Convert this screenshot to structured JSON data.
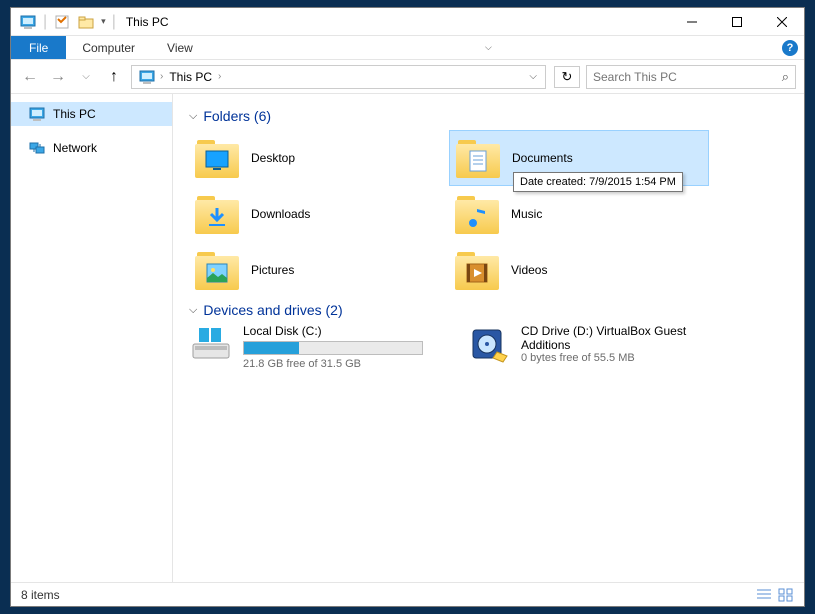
{
  "window": {
    "title": "This PC"
  },
  "menubar": {
    "file": "File",
    "computer": "Computer",
    "view": "View"
  },
  "breadcrumb": {
    "current": "This PC"
  },
  "search": {
    "placeholder": "Search This PC"
  },
  "sidebar": {
    "items": [
      {
        "label": "This PC",
        "selected": true
      },
      {
        "label": "Network",
        "selected": false
      }
    ]
  },
  "sections": {
    "folders": {
      "title": "Folders",
      "count": "(6)",
      "items": [
        {
          "label": "Desktop"
        },
        {
          "label": "Documents",
          "selected": true
        },
        {
          "label": "Downloads"
        },
        {
          "label": "Music"
        },
        {
          "label": "Pictures"
        },
        {
          "label": "Videos"
        }
      ]
    },
    "drives": {
      "title": "Devices and drives",
      "count": "(2)",
      "items": [
        {
          "label": "Local Disk (C:)",
          "sub": "21.8 GB free of 31.5 GB",
          "fill_pct": 31
        },
        {
          "label": "CD Drive (D:) VirtualBox Guest Additions",
          "sub": "0 bytes free of 55.5 MB"
        }
      ]
    }
  },
  "tooltip": "Date created: 7/9/2015 1:54 PM",
  "statusbar": {
    "count": "8 items"
  }
}
